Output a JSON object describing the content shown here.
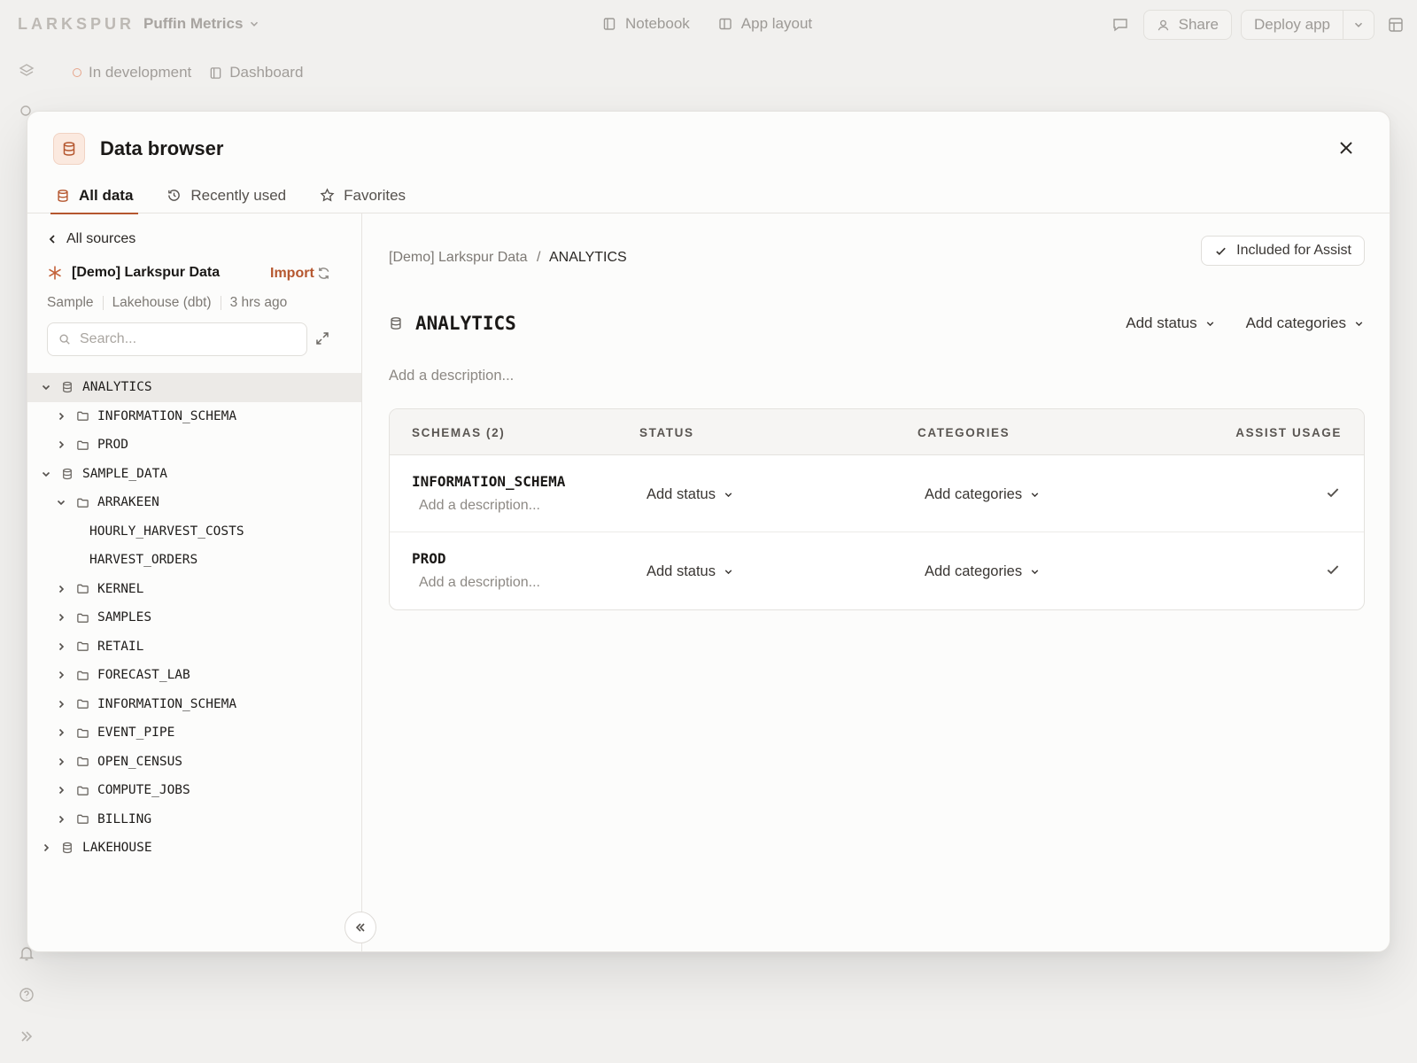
{
  "app": {
    "logo": "LARKSPUR",
    "project": "Puffin Metrics",
    "nav": {
      "notebook": "Notebook",
      "app_layout": "App layout"
    },
    "share": "Share",
    "deploy": "Deploy app",
    "status": "In development",
    "dashboard": "Dashboard"
  },
  "modal": {
    "title": "Data browser",
    "tabs": [
      {
        "label": "All data"
      },
      {
        "label": "Recently used"
      },
      {
        "label": "Favorites"
      }
    ]
  },
  "sidebar": {
    "back_label": "All sources",
    "source_name": "[Demo] Larkspur Data",
    "import_label": "Import",
    "meta": [
      "Sample",
      "Lakehouse (dbt)",
      "3 hrs ago"
    ],
    "search_placeholder": "Search...",
    "tree": [
      {
        "label": "ANALYTICS",
        "level": 0,
        "kind": "database",
        "expander": "open",
        "selected": true
      },
      {
        "label": "INFORMATION_SCHEMA",
        "level": 1,
        "kind": "folder",
        "expander": "closed"
      },
      {
        "label": "PROD",
        "level": 1,
        "kind": "folder",
        "expander": "closed"
      },
      {
        "label": "SAMPLE_DATA",
        "level": 0,
        "kind": "database",
        "expander": "open"
      },
      {
        "label": "ARRAKEEN",
        "level": 1,
        "kind": "folder",
        "expander": "open"
      },
      {
        "label": "HOURLY_HARVEST_COSTS",
        "level": 2,
        "kind": "table",
        "expander": "none"
      },
      {
        "label": "HARVEST_ORDERS",
        "level": 2,
        "kind": "table",
        "expander": "none"
      },
      {
        "label": "KERNEL",
        "level": 1,
        "kind": "folder",
        "expander": "closed"
      },
      {
        "label": "SAMPLES",
        "level": 1,
        "kind": "folder",
        "expander": "closed"
      },
      {
        "label": "RETAIL",
        "level": 1,
        "kind": "folder",
        "expander": "closed"
      },
      {
        "label": "FORECAST_LAB",
        "level": 1,
        "kind": "folder",
        "expander": "closed"
      },
      {
        "label": "INFORMATION_SCHEMA",
        "level": 1,
        "kind": "folder",
        "expander": "closed"
      },
      {
        "label": "EVENT_PIPE",
        "level": 1,
        "kind": "folder",
        "expander": "closed"
      },
      {
        "label": "OPEN_CENSUS",
        "level": 1,
        "kind": "folder",
        "expander": "closed"
      },
      {
        "label": "COMPUTE_JOBS",
        "level": 1,
        "kind": "folder",
        "expander": "closed"
      },
      {
        "label": "BILLING",
        "level": 1,
        "kind": "folder",
        "expander": "closed"
      },
      {
        "label": "LAKEHOUSE",
        "level": 0,
        "kind": "database",
        "expander": "closed"
      }
    ]
  },
  "main": {
    "breadcrumb": {
      "source": "[Demo] Larkspur Data",
      "separator": "/",
      "current": "ANALYTICS"
    },
    "included_label": "Included for Assist",
    "title": "ANALYTICS",
    "add_status": "Add status",
    "add_categories": "Add categories",
    "description_placeholder": "Add a description...",
    "table": {
      "headers": {
        "schemas": "SCHEMAS (2)",
        "status": "STATUS",
        "categories": "CATEGORIES",
        "assist": "ASSIST USAGE"
      },
      "rows": [
        {
          "name": "INFORMATION_SCHEMA",
          "description": "Add a description...",
          "status": "Add status",
          "categories": "Add categories",
          "assist": true
        },
        {
          "name": "PROD",
          "description": "Add a description...",
          "status": "Add status",
          "categories": "Add categories",
          "assist": true
        }
      ]
    }
  },
  "colors": {
    "accent": "#b5572f",
    "bg": "#f1f0ee",
    "panel": "#fcfcfb"
  },
  "icons": [
    "chevron-down-icon",
    "notebook-icon",
    "layout-icon",
    "comment-icon",
    "user-icon",
    "panel-icon",
    "layers-icon",
    "database-icon",
    "close-icon",
    "history-icon",
    "star-icon",
    "chevron-left-icon",
    "asterisk-icon",
    "refresh-icon",
    "search-icon",
    "expand-icon",
    "chevron-right-icon",
    "folder-icon",
    "check-icon",
    "double-chevron-left-icon",
    "bell-icon",
    "help-icon",
    "double-chevron-right-icon"
  ]
}
